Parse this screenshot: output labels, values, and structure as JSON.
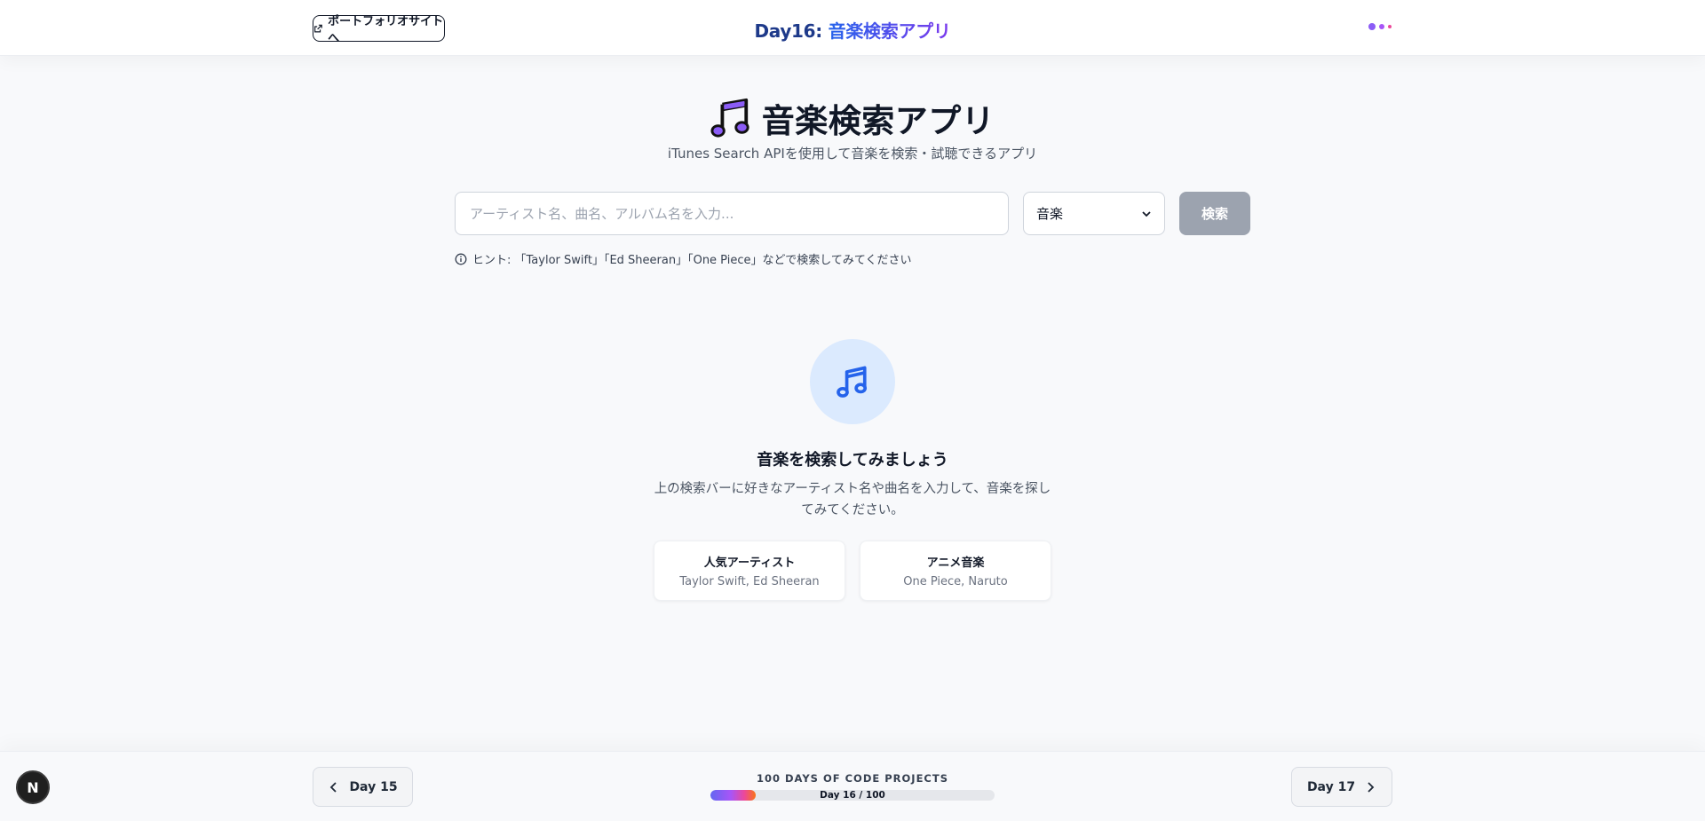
{
  "header": {
    "portfolio_label": "ポートフォリオサイトへ",
    "title_day": "Day16: ",
    "title_name": "音楽検索アプリ",
    "dot_colors": [
      "#8b5cf6",
      "#a855f7",
      "#ec4899"
    ]
  },
  "hero": {
    "icon": "musical-notes-icon",
    "title": "音楽検索アプリ",
    "subtitle": "iTunes Search APIを使用して音楽を検索・試聴できるアプリ"
  },
  "search": {
    "placeholder": "アーティスト名、曲名、アルバム名を入力...",
    "value": "",
    "type_selected": "音楽",
    "button_label": "検索",
    "hint": "ヒント: 「Taylor Swift」「Ed Sheeran」「One Piece」などで検索してみてください"
  },
  "empty_state": {
    "icon": "music-note-icon",
    "title": "音楽を検索してみましょう",
    "description": "上の検索バーに好きなアーティスト名や曲名を入力して、音楽を探してみてください。",
    "cards": [
      {
        "title": "人気アーティスト",
        "subtitle": "Taylor Swift, Ed Sheeran"
      },
      {
        "title": "アニメ音楽",
        "subtitle": "One Piece, Naruto"
      }
    ]
  },
  "footer": {
    "prev_label": "Day 15",
    "next_label": "Day 17",
    "progress_label": "100 DAYS OF CODE PROJECTS",
    "progress_text": "Day 16 / 100",
    "progress_fraction": 0.16
  },
  "badge": {
    "letter": "N"
  },
  "colors": {
    "accent_blue": "#2563eb",
    "accent_purple": "#7c3aed",
    "disabled_button": "#9ca3af",
    "icon_circle_bg": "#dbeafe"
  }
}
